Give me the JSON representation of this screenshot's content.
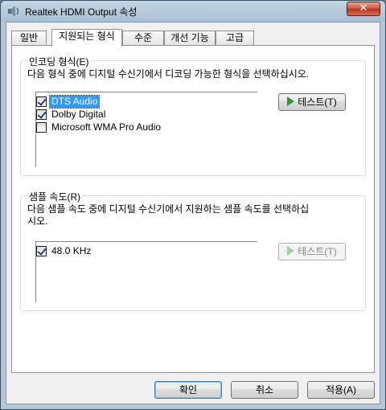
{
  "window": {
    "title": "Realtek HDMI Output 속성",
    "close_label": "✕"
  },
  "tabs": [
    {
      "label": "일반"
    },
    {
      "label": "지원되는 형식"
    },
    {
      "label": "수준"
    },
    {
      "label": "개선 기능"
    },
    {
      "label": "고급"
    }
  ],
  "encoding": {
    "group_label": "인코딩 형식(E)",
    "description": "다음 형식 중에 디지털 수신기에서 디코딩 가능한 형식을 선택하십시오.",
    "items": [
      {
        "label": "DTS Audio",
        "checked": true,
        "selected": true
      },
      {
        "label": "Dolby Digital",
        "checked": true,
        "selected": false
      },
      {
        "label": "Microsoft WMA Pro Audio",
        "checked": false,
        "selected": false
      }
    ],
    "test_button": "테스트(T)"
  },
  "sample_rate": {
    "group_label": "샘플 속도(R)",
    "description_line1": "다음 샘플 속도 중에 디지털 수신기에서 지원하는 샘플 속도를 선택하십",
    "description_line2": "시오.",
    "items": [
      {
        "label": "48.0 KHz",
        "checked": true
      }
    ],
    "test_button": "테스트(T)"
  },
  "footer": {
    "ok": "확인",
    "cancel": "취소",
    "apply": "적용(A)"
  }
}
